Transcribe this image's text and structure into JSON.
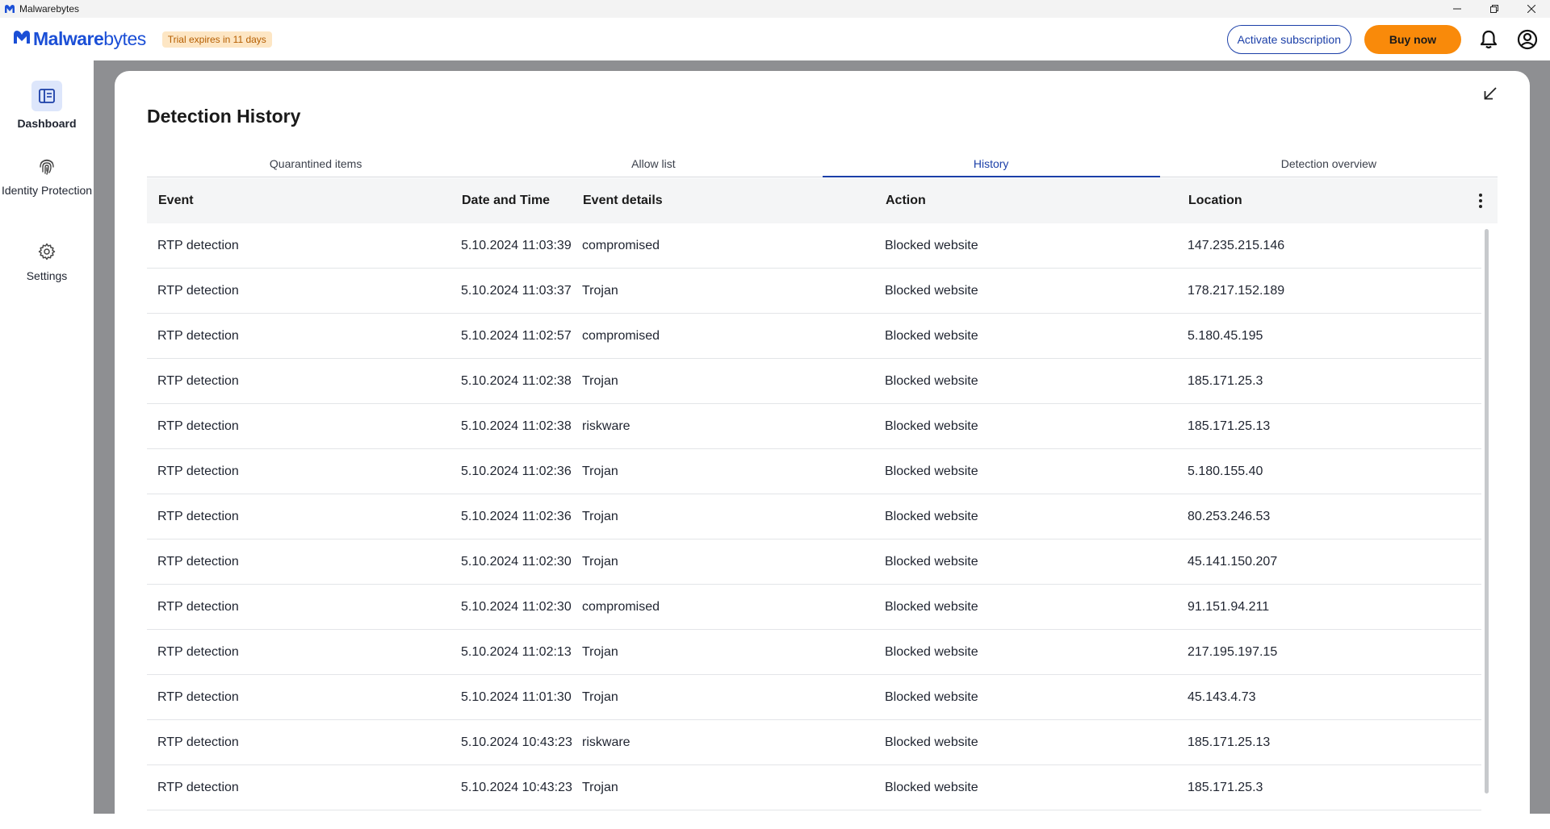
{
  "window": {
    "title": "Malwarebytes"
  },
  "header": {
    "brand_bold": "Malware",
    "brand_light": "bytes",
    "trial_badge": "Trial expires in 11 days",
    "activate_label": "Activate subscription",
    "buy_label": "Buy now"
  },
  "sidebar": {
    "items": [
      {
        "label": "Dashboard",
        "icon": "dashboard-icon",
        "active": true
      },
      {
        "label": "Identity Protection",
        "icon": "fingerprint-icon",
        "active": false
      },
      {
        "label": "Settings",
        "icon": "gear-icon",
        "active": false
      }
    ]
  },
  "panel": {
    "title": "Detection History",
    "tabs": [
      {
        "label": "Quarantined items",
        "active": false
      },
      {
        "label": "Allow list",
        "active": false
      },
      {
        "label": "History",
        "active": true
      },
      {
        "label": "Detection overview",
        "active": false
      }
    ],
    "columns": {
      "event": "Event",
      "date": "Date and Time",
      "details": "Event details",
      "action": "Action",
      "location": "Location"
    },
    "rows": [
      {
        "event": "RTP detection",
        "date": "5.10.2024 11:03:39",
        "details": "compromised",
        "action": "Blocked website",
        "location": "147.235.215.146"
      },
      {
        "event": "RTP detection",
        "date": "5.10.2024 11:03:37",
        "details": "Trojan",
        "action": "Blocked website",
        "location": "178.217.152.189"
      },
      {
        "event": "RTP detection",
        "date": "5.10.2024 11:02:57",
        "details": "compromised",
        "action": "Blocked website",
        "location": "5.180.45.195"
      },
      {
        "event": "RTP detection",
        "date": "5.10.2024 11:02:38",
        "details": "Trojan",
        "action": "Blocked website",
        "location": "185.171.25.3"
      },
      {
        "event": "RTP detection",
        "date": "5.10.2024 11:02:38",
        "details": "riskware",
        "action": "Blocked website",
        "location": "185.171.25.13"
      },
      {
        "event": "RTP detection",
        "date": "5.10.2024 11:02:36",
        "details": "Trojan",
        "action": "Blocked website",
        "location": "5.180.155.40"
      },
      {
        "event": "RTP detection",
        "date": "5.10.2024 11:02:36",
        "details": "Trojan",
        "action": "Blocked website",
        "location": "80.253.246.53"
      },
      {
        "event": "RTP detection",
        "date": "5.10.2024 11:02:30",
        "details": "Trojan",
        "action": "Blocked website",
        "location": "45.141.150.207"
      },
      {
        "event": "RTP detection",
        "date": "5.10.2024 11:02:30",
        "details": "compromised",
        "action": "Blocked website",
        "location": "91.151.94.211"
      },
      {
        "event": "RTP detection",
        "date": "5.10.2024 11:02:13",
        "details": "Trojan",
        "action": "Blocked website",
        "location": "217.195.197.15"
      },
      {
        "event": "RTP detection",
        "date": "5.10.2024 11:01:30",
        "details": "Trojan",
        "action": "Blocked website",
        "location": "45.143.4.73"
      },
      {
        "event": "RTP detection",
        "date": "5.10.2024 10:43:23",
        "details": "riskware",
        "action": "Blocked website",
        "location": "185.171.25.13"
      },
      {
        "event": "RTP detection",
        "date": "5.10.2024 10:43:23",
        "details": "Trojan",
        "action": "Blocked website",
        "location": "185.171.25.3"
      }
    ]
  },
  "colors": {
    "brand": "#1b4fd6",
    "accent": "#1b3fa8",
    "buy_button": "#f98a0a",
    "trial_bg": "#fde6c4",
    "trial_text": "#b55e00",
    "backdrop": "#8e8f92"
  }
}
